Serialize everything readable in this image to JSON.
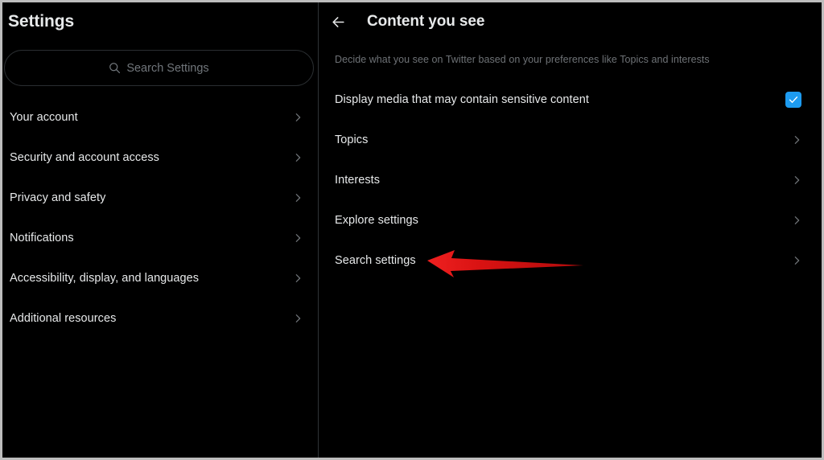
{
  "app": {
    "theme": "dark",
    "background_color": "#000000",
    "text_color": "#e7e9ea",
    "muted_text_color": "#71767b",
    "divider_color": "#2f3336",
    "accent_color": "#1d9bf0",
    "annotation_color": "#e01b1b"
  },
  "sidebar": {
    "title": "Settings",
    "search": {
      "placeholder": "Search Settings",
      "value": "",
      "icon": "search-icon"
    },
    "items": [
      {
        "label": "Your account",
        "chevron": "chevron-right-icon"
      },
      {
        "label": "Security and account access",
        "chevron": "chevron-right-icon"
      },
      {
        "label": "Privacy and safety",
        "chevron": "chevron-right-icon"
      },
      {
        "label": "Notifications",
        "chevron": "chevron-right-icon"
      },
      {
        "label": "Accessibility, display, and languages",
        "chevron": "chevron-right-icon"
      },
      {
        "label": "Additional resources",
        "chevron": "chevron-right-icon"
      }
    ]
  },
  "panel": {
    "back_icon": "arrow-left-icon",
    "title": "Content you see",
    "description": "Decide what you see on Twitter based on your preferences like Topics and interests",
    "rows": [
      {
        "label": "Display media that may contain sensitive content",
        "control": "checkbox",
        "checked": true,
        "checkbox_color": "#1d9bf0",
        "check_icon": "checkmark-icon"
      },
      {
        "label": "Topics",
        "control": "chevron",
        "chevron": "chevron-right-icon"
      },
      {
        "label": "Interests",
        "control": "chevron",
        "chevron": "chevron-right-icon"
      },
      {
        "label": "Explore settings",
        "control": "chevron",
        "chevron": "chevron-right-icon"
      },
      {
        "label": "Search settings",
        "control": "chevron",
        "chevron": "chevron-right-icon"
      }
    ]
  },
  "annotation": {
    "type": "arrow",
    "color": "#e01b1b",
    "points_to": "Search settings",
    "direction": "left"
  }
}
